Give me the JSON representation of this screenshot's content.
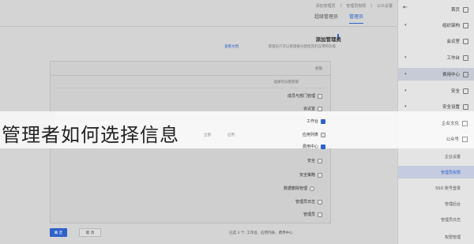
{
  "breadcrumb": [
    "公众设置",
    "管理员权限",
    "添加管理员"
  ],
  "tabs": [
    {
      "label": "管理员",
      "active": true
    },
    {
      "label": "超级管理员",
      "active": false
    }
  ],
  "section": {
    "title": "添加管理员",
    "desc": "管理员只可以管理被分配给其的应用和功能",
    "link": "查看文档"
  },
  "panel": {
    "header": "权限",
    "group_label": "选择可分配权限",
    "options": [
      {
        "label": "成员与部门管理",
        "selected": false
      },
      {
        "label": "会议室",
        "selected": false
      },
      {
        "label": "工作台",
        "selected": true
      },
      {
        "label": "应用列表",
        "selected": false
      },
      {
        "label": "费用中心",
        "selected": true
      },
      {
        "label": "安全",
        "selected": false
      },
      {
        "label": "安全策略",
        "selected": false
      },
      {
        "label": "数据删除管理",
        "selected": false
      },
      {
        "label": "管理员日志",
        "selected": false
      },
      {
        "label": "管理员",
        "selected": false
      }
    ],
    "inline_hints": [
      "应用",
      "全部"
    ]
  },
  "footer": {
    "primary": "确 定",
    "secondary": "取 消",
    "summary": "已选 3 个: 工作台、应用列表、费用中心"
  },
  "sidebar": {
    "collapse_glyph": "⇤",
    "items": [
      {
        "label": "首页",
        "chev": "",
        "highlight": false
      },
      {
        "label": "组织架构",
        "chev": "▾",
        "highlight": false
      },
      {
        "label": "会议室",
        "chev": "",
        "highlight": false
      },
      {
        "label": "工作台",
        "chev": "▾",
        "highlight": false
      },
      {
        "label": "费用中心",
        "chev": "▾",
        "highlight": true
      },
      {
        "label": "安全",
        "chev": "▾",
        "highlight": false
      },
      {
        "label": "安全设置",
        "chev": "▾",
        "highlight": false
      }
    ],
    "subitems": [
      {
        "label": "企业设置",
        "active": false
      },
      {
        "label": "管理员权限",
        "active": true
      },
      {
        "label": "SSO 账号登录",
        "active": false
      },
      {
        "label": "管理后台",
        "active": false
      },
      {
        "label": "管理员日志",
        "active": false
      },
      {
        "label": "权限管理",
        "active": false
      }
    ],
    "band_items": [
      "企业文化",
      "公众号"
    ]
  },
  "overlay_title": "管理者如何选择信息"
}
